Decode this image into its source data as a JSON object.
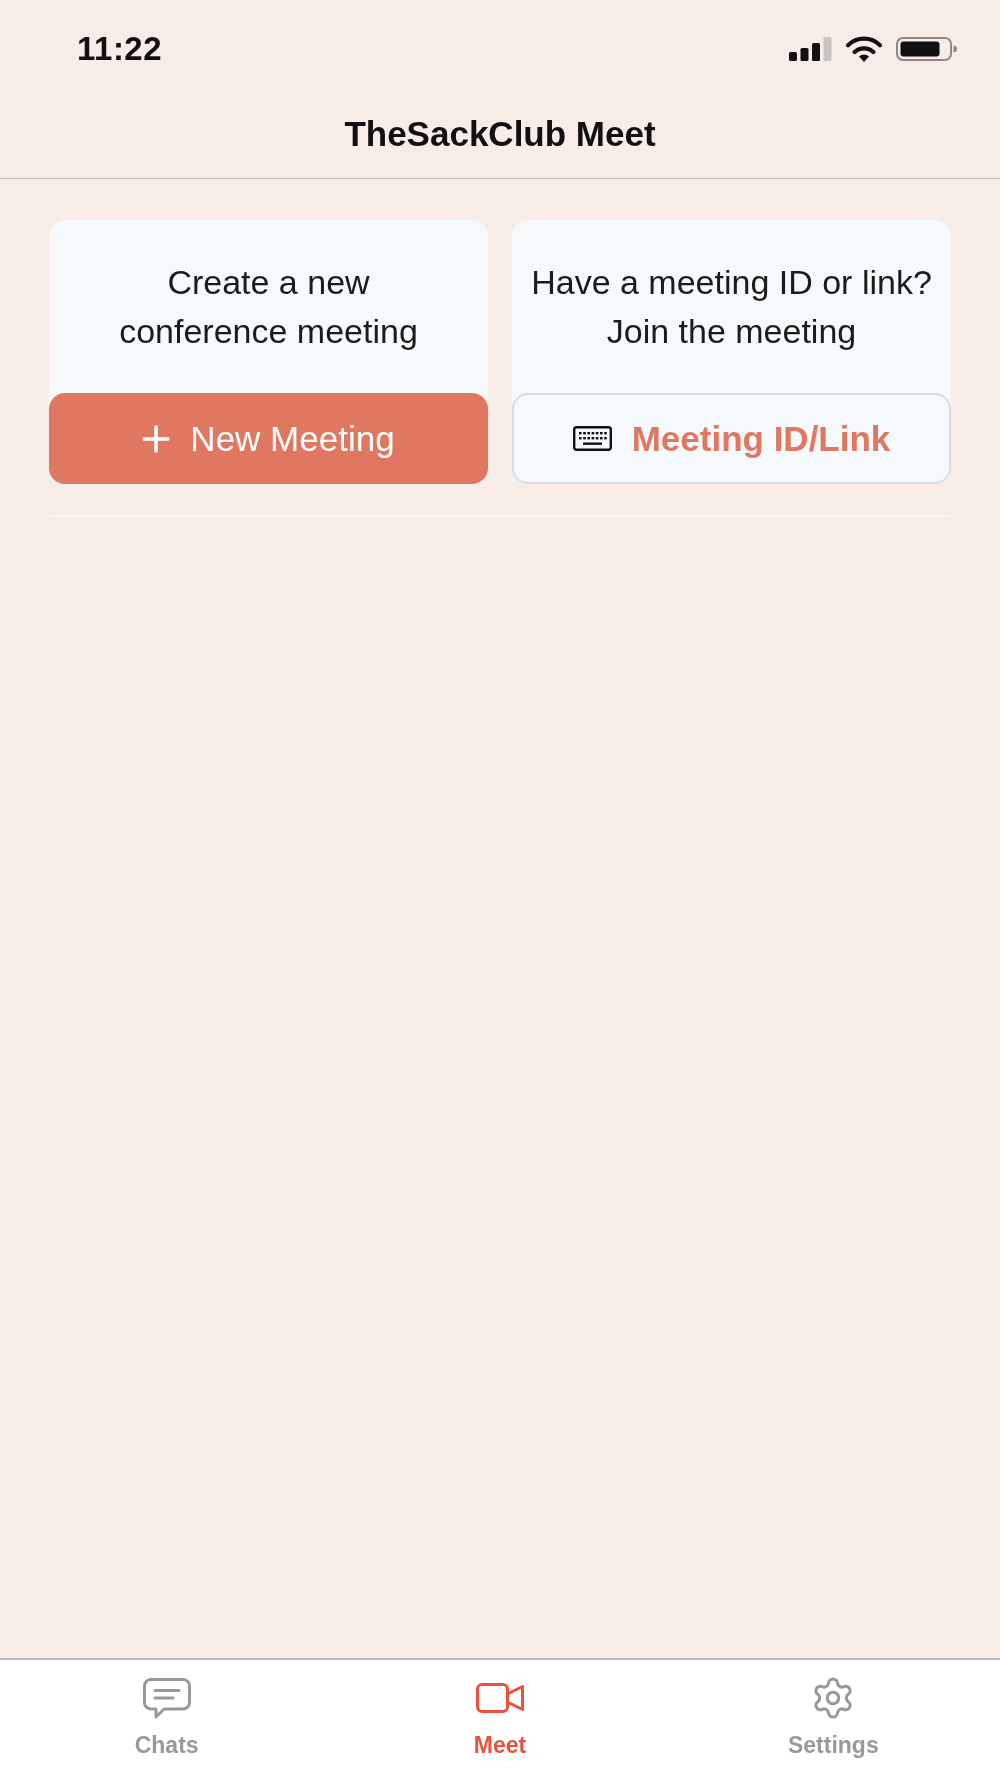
{
  "status_bar": {
    "time": "11:22"
  },
  "header": {
    "title": "TheSackClub Meet"
  },
  "cards": [
    {
      "description": "Create a new\nconference meeting",
      "button": {
        "kind": "filled",
        "label": "New Meeting"
      }
    },
    {
      "description": "Have a meeting ID or link?\nJoin the meeting",
      "button": {
        "kind": "outlined",
        "label": "Meeting ID/Link"
      }
    }
  ],
  "tab_bar": {
    "tabs": [
      {
        "label": "Chats",
        "selected": false
      },
      {
        "label": "Meet",
        "selected": true
      },
      {
        "label": "Settings",
        "selected": false
      }
    ]
  }
}
